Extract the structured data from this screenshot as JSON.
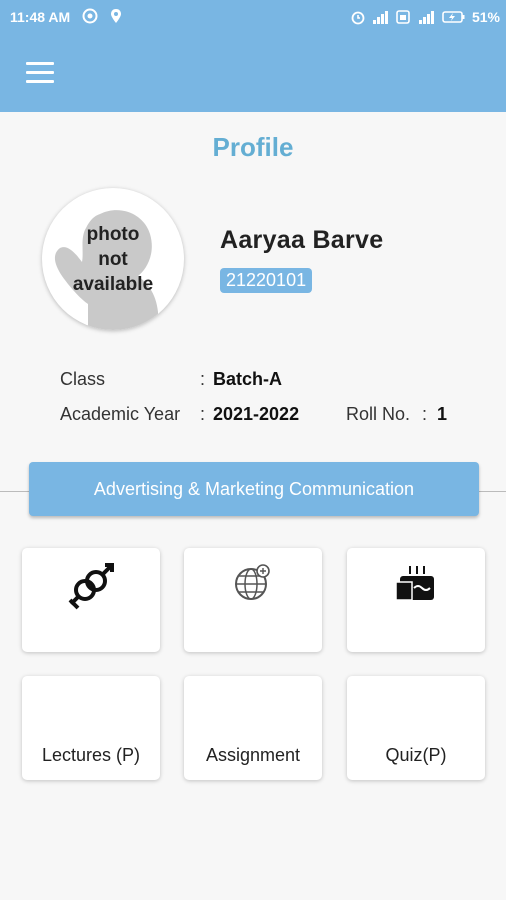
{
  "status_bar": {
    "time": "11:48 AM",
    "battery": "51%",
    "icons": [
      "target-icon",
      "location-pin-icon",
      "alarm-icon",
      "signal-icon",
      "sim-icon",
      "signal-4g-icon",
      "battery-charging-icon"
    ]
  },
  "app_bar": {
    "menu_icon": "hamburger-menu-icon",
    "color": "#79b6e3"
  },
  "profile": {
    "title": "Profile",
    "avatar_text": "photo\nnot\navailable",
    "name": "Aaryaa  Barve",
    "id": "21220101",
    "class_label": "Class",
    "class_value": "Batch-A",
    "year_label": "Academic Year",
    "year_value": "2021-2022",
    "roll_label": "Roll No.",
    "roll_value": "1",
    "colon": ":"
  },
  "subject": {
    "label": "Advertising & Marketing Communication"
  },
  "cards_top": [
    {
      "icon": "gender-symbol-icon"
    },
    {
      "icon": "globe-icon"
    },
    {
      "icon": "birthday-cake-icon"
    }
  ],
  "cards_bottom": [
    {
      "label": "Lectures (P)"
    },
    {
      "label": "Assignment"
    },
    {
      "label": "Quiz(P)"
    }
  ],
  "colors": {
    "accent": "#79b6e3",
    "title": "#64aed3"
  }
}
